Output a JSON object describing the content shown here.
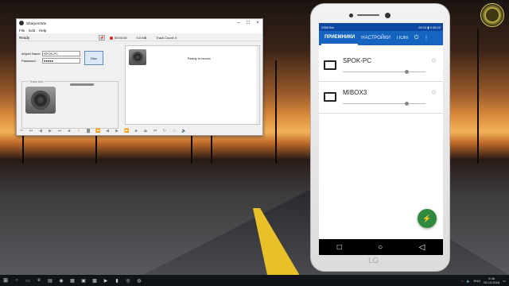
{
  "app": {
    "window_title": "SharpAirWin",
    "menu": [
      "File",
      "Edit",
      "Help"
    ],
    "status": "Ready",
    "rec_time": "00:00:00",
    "size": "0.0 MB",
    "track_count": "Track Count: 0",
    "airport_name_label": "Airport Name",
    "airport_name_value": "SPOK-PC",
    "password_label": "Password",
    "password_value": "●●●●●",
    "connect_label": "Disc",
    "track_info_label": "Track Info",
    "ready_to_record": "Ready to record."
  },
  "phone": {
    "status_left": "2356 B/s",
    "status_time": "09:10 ▮ 9:46:22",
    "tabs": [
      "ПРИЕМНИКИ",
      "НАСТРОЙКИ",
      "ПОМ"
    ],
    "devices": [
      {
        "name": "SPOK-PC",
        "icon": "airplay-icon",
        "volume": 0.77
      },
      {
        "name": "MIBOX3",
        "icon": "cast-icon",
        "volume": 0.77
      }
    ],
    "brand": "LG"
  },
  "taskbar": {
    "lang": "ENG",
    "time": "9:46",
    "date": "09.10.2016"
  },
  "colors": {
    "phone_appbar": "#1565c0",
    "phone_statusbar": "#0d47a1",
    "fab": "#2e8b3e"
  }
}
